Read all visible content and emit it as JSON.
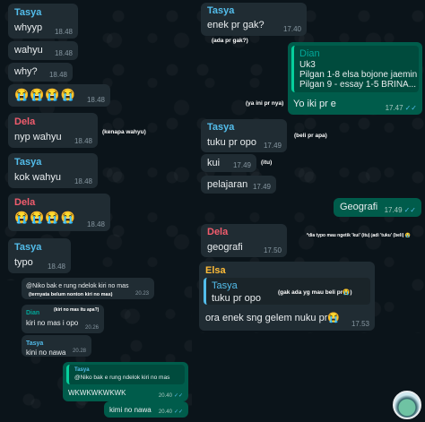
{
  "left": {
    "messages": [
      {
        "sender": "Tasya",
        "text": "whyyp",
        "time": "18.48"
      },
      {
        "text": "wahyu",
        "time": "18.48"
      },
      {
        "text": "why?",
        "time": "18.48"
      },
      {
        "text": "😭😭😭😭",
        "time": "18.48"
      },
      {
        "sender": "Dela",
        "text": "nyp wahyu",
        "time": "18.48"
      },
      {
        "sender": "Tasya",
        "text": "kok wahyu",
        "time": "18.48"
      },
      {
        "sender": "Dela",
        "text": "😭😭😭😭",
        "time": "18.48"
      },
      {
        "sender": "Tasya",
        "text": "typo",
        "time": "18.48"
      }
    ],
    "note_kenapa": "(kenapa wahyu)",
    "bottom": [
      {
        "quote": "@Niko bak e rung ndelok kiri no mas",
        "time": "20.23"
      },
      {
        "sender": "Dian",
        "text": "kiri no mas i opo",
        "time": "20.26"
      },
      {
        "sender": "Tasya",
        "text": "kini no nawa",
        "time": "20.28"
      },
      {
        "sender": "Tasya",
        "quote": "@Niko bak e rung ndelok kiri no mas",
        "text": "WKWKWKWKWK",
        "time": "20.40"
      },
      {
        "text": "kimi no nawa",
        "time": "20.40"
      }
    ],
    "note_ternyata": "(ternyata belum nonton kiri no mas)",
    "note_itu_apa": "(kiri no mas itu apa?)"
  },
  "right": {
    "m1": {
      "sender": "Tasya",
      "text": "enek pr gak?",
      "time": "17.40"
    },
    "note_ada_pr": "(ada pr gak?)",
    "dian": {
      "sender": "Dian",
      "lines": [
        "Uk3",
        "Pilgan 1-8 elsa bojone jaemin",
        "Pilgan 9 - essay 1-5 BRINA..."
      ],
      "text": "Yo iki pr e",
      "time": "17.47"
    },
    "note_ini_pr": "(ya ini pr nya)",
    "tasya": {
      "sender": "Tasya",
      "text": "tuku pr opo",
      "time": "17.49"
    },
    "note_beli_pr": "(beli pr apa)",
    "kui": {
      "text": "kui",
      "time": "17.49"
    },
    "note_itu": "(itu)",
    "pelajaran": {
      "text": "pelajaran",
      "time": "17.49"
    },
    "geografi_out": {
      "text": "Geografi",
      "time": "17.49"
    },
    "note_typo": "*dia typo mau ngetik 'kui' (itu) jadi 'tuku' (beli) 😭",
    "dela": {
      "sender": "Dela",
      "text": "geografi",
      "time": "17.50"
    },
    "elsa": {
      "sender": "Elsa",
      "quote_sender": "Tasya",
      "quote_text": "tuku pr opo",
      "text": "ora enek sng gelem nuku pr😭",
      "time": "17.53"
    },
    "note_gak_ada": "(gak ada yg mau beli pr😭)"
  },
  "colors": {
    "tasya": "#53bdeb",
    "dela": "#f15c6d",
    "dian": "#02a698",
    "elsa": "#ffbc38"
  }
}
